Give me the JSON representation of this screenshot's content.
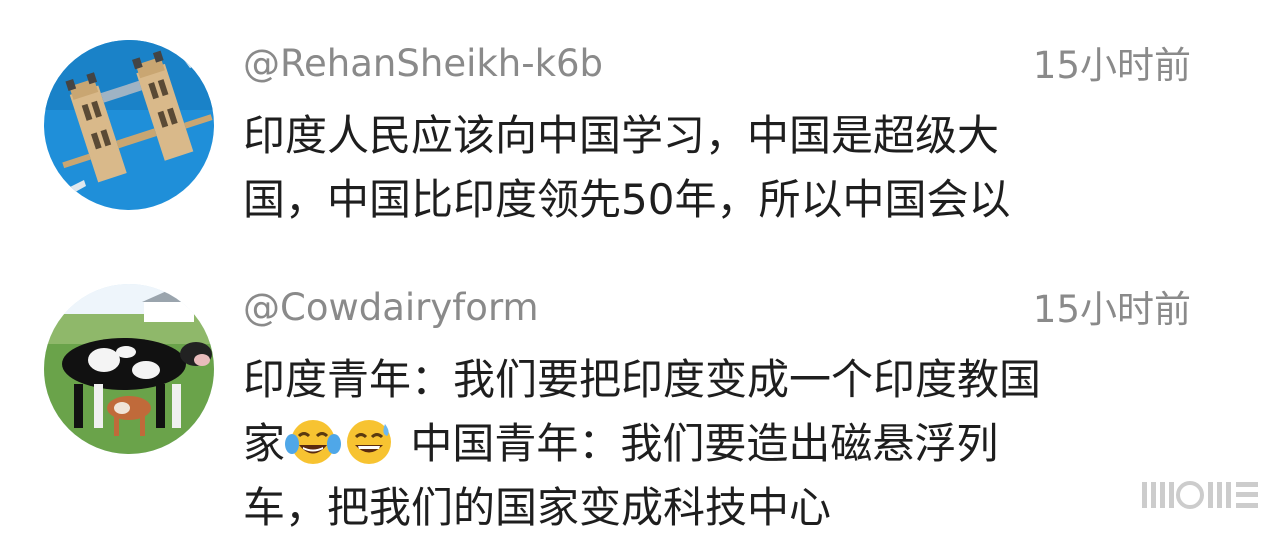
{
  "comments": [
    {
      "username": "@RehanSheikh-k6b",
      "time": "15小时前",
      "avatar_icon": "tower-bridge-icon",
      "lines": [
        "印度人民应该向中国学习，中国是超级大",
        "国，中国比印度领先50年，所以中国会以"
      ]
    },
    {
      "username": "@Cowdairyform",
      "time": "15小时前",
      "avatar_icon": "cows-icon",
      "line1": "印度青年：我们要把印度变成一个印度教国",
      "line2_start": "家",
      "emoji1": "tears-of-joy-emoji",
      "emoji2": "grinning-sweat-emoji",
      "line2_end": " 中国青年：我们要造出磁悬浮列",
      "line3": "车，把我们的国家变成科技中心"
    }
  ],
  "colors": {
    "meta": "#8a8a8a",
    "text": "#1e1e1e",
    "avatar1_bg": "#1d8fd8",
    "emoji_yellow": "#f7c331"
  }
}
